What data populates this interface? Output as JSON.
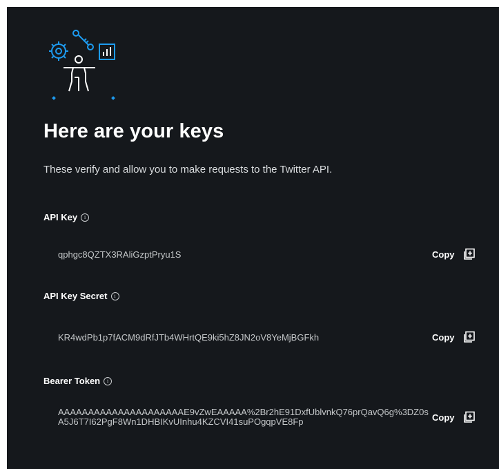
{
  "header": {
    "title": "Here are your keys",
    "subtitle": "These verify and allow you to make requests to the Twitter API."
  },
  "keys": [
    {
      "label": "API Key",
      "value": "qphgc8QZTX3RAliGzptPryu1S",
      "copy_label": "Copy"
    },
    {
      "label": "API Key Secret",
      "value": "KR4wdPb1p7fACM9dRfJTb4WHrtQE9ki5hZ8JN2oV8YeMjBGFkh",
      "copy_label": "Copy"
    },
    {
      "label": "Bearer Token",
      "value": "AAAAAAAAAAAAAAAAAAAAAE9vZwEAAAAA%2Br2hE91DxfUblvnkQ76prQavQ6g%3DZ0sA5J6T7I62PgF8Wn1DHBIKvUInhu4KZCVI41suPOgqpVE8Fp",
      "copy_label": "Copy"
    }
  ],
  "icons": {
    "illustration": "developer-keys-illustration",
    "info": "info-icon",
    "copy": "copy-icon"
  },
  "colors": {
    "background": "#15181c",
    "accent": "#1d9bf0",
    "text": "#e7e9ea"
  }
}
